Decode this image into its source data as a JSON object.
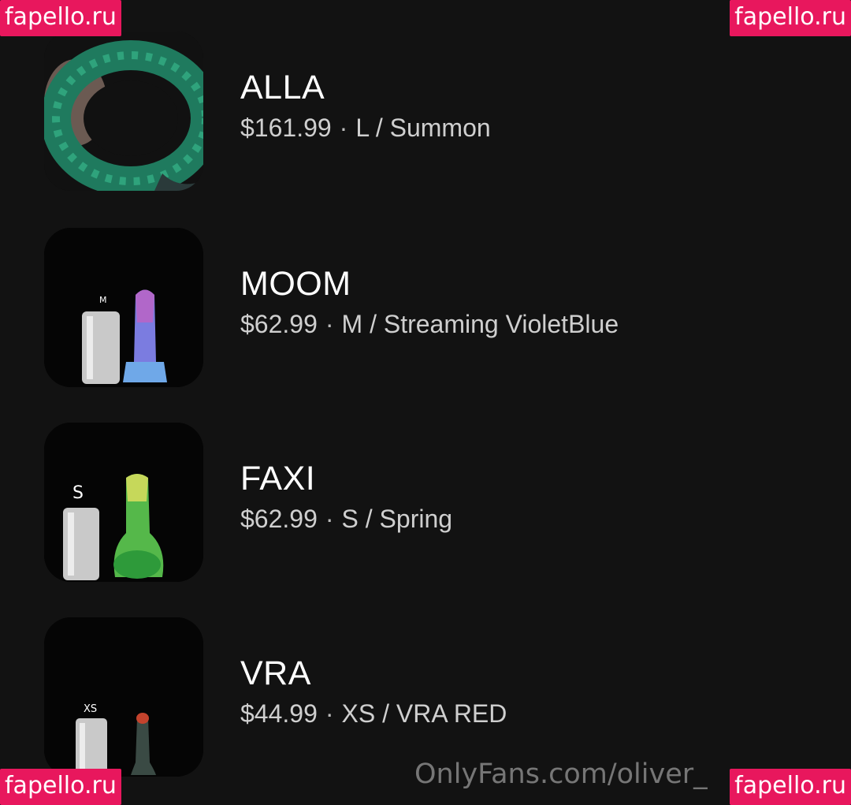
{
  "watermarks": {
    "top_left": "fapello.ru",
    "top_right": "fapello.ru",
    "bottom_left": "fapello.ru",
    "bottom_right": "fapello.ru"
  },
  "credit": "OnlyFans.com/oliver_",
  "products": [
    {
      "name": "ALLA",
      "price": "$161.99",
      "variant": "L / Summon",
      "image_icon": "tentacle-ring-icon"
    },
    {
      "name": "MOOM",
      "price": "$62.99",
      "variant": "M / Streaming VioletBlue",
      "size_label": "M",
      "image_icon": "product-with-can-icon"
    },
    {
      "name": "FAXI",
      "price": "$62.99",
      "variant": "S / Spring",
      "size_label": "S",
      "image_icon": "product-with-can-icon"
    },
    {
      "name": "VRA",
      "price": "$44.99",
      "variant": "XS / VRA RED",
      "size_label": "XS",
      "image_icon": "product-with-can-icon"
    }
  ],
  "separator": "·",
  "colors": {
    "background": "#121212",
    "watermark": "#e8175d",
    "meta_text": "#cfcfcf"
  }
}
